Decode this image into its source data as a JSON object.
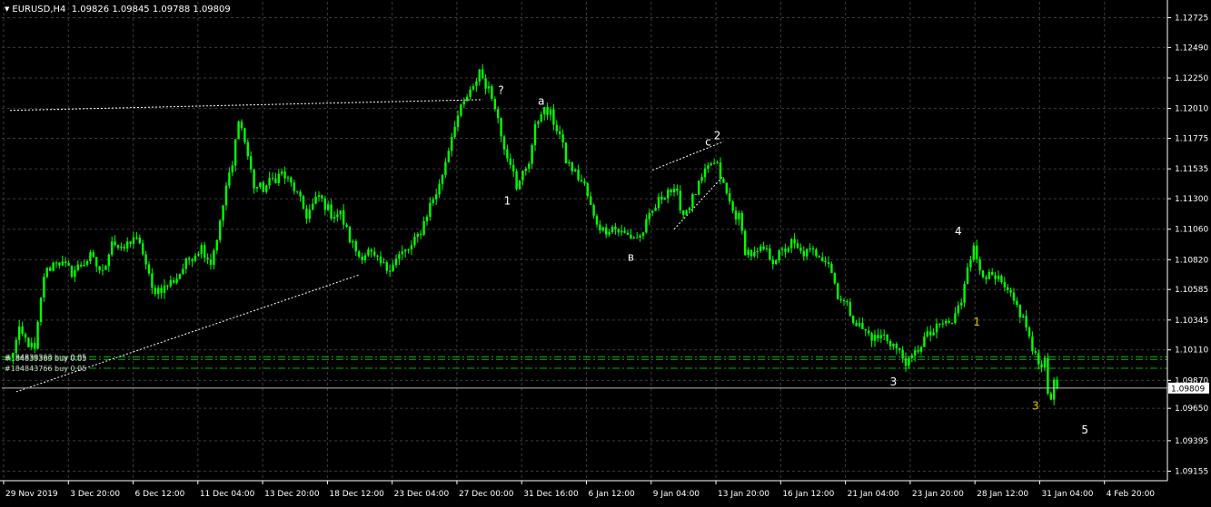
{
  "header": {
    "symbol": "EURUSD,H4",
    "open": "1.09826",
    "high": "1.09845",
    "low": "1.09788",
    "close": "1.09809"
  },
  "colors": {
    "background": "#000000",
    "grid": "#3c3c3c",
    "candle": "#00ff00",
    "axis": "#ffffff",
    "order_line": "#00b400",
    "wave_label": "#ffffff",
    "wave_label_alt": "#e6c800"
  },
  "chart_data": {
    "type": "candlestick",
    "ylim": [
      1.0908,
      1.1285
    ],
    "y_ticks": [
      "1.12725",
      "1.12490",
      "1.12250",
      "1.12010",
      "1.11775",
      "1.11535",
      "1.11300",
      "1.11060",
      "1.10820",
      "1.10585",
      "1.10345",
      "1.10110",
      "1.09870",
      "1.09650",
      "1.09395",
      "1.09155"
    ],
    "x_ticks": [
      "29 Nov 2019",
      "3 Dec 20:00",
      "6 Dec 12:00",
      "11 Dec 04:00",
      "13 Dec 20:00",
      "18 Dec 12:00",
      "23 Dec 04:00",
      "27 Dec 00:00",
      "31 Dec 16:00",
      "6 Jan 12:00",
      "9 Jan 04:00",
      "13 Jan 20:00",
      "16 Jan 12:00",
      "21 Jan 04:00",
      "23 Jan 20:00",
      "28 Jan 12:00",
      "31 Jan 04:00",
      "4 Feb 20:00"
    ],
    "current_price": "1.09809",
    "price_path": [
      [
        0,
        1.1003
      ],
      [
        3,
        1.1025
      ],
      [
        8,
        1.101
      ],
      [
        11,
        1.107
      ],
      [
        15,
        1.1082
      ],
      [
        20,
        1.1072
      ],
      [
        26,
        1.1084
      ],
      [
        30,
        1.1071
      ],
      [
        33,
        1.1098
      ],
      [
        36,
        1.1088
      ],
      [
        40,
        1.11
      ],
      [
        43,
        1.1088
      ],
      [
        46,
        1.1058
      ],
      [
        50,
        1.106
      ],
      [
        54,
        1.1068
      ],
      [
        58,
        1.1083
      ],
      [
        62,
        1.1092
      ],
      [
        65,
        1.108
      ],
      [
        68,
        1.111
      ],
      [
        70,
        1.114
      ],
      [
        72,
        1.1155
      ],
      [
        74,
        1.1195
      ],
      [
        76,
        1.1175
      ],
      [
        79,
        1.114
      ],
      [
        82,
        1.1138
      ],
      [
        85,
        1.1145
      ],
      [
        88,
        1.115
      ],
      [
        92,
        1.1138
      ],
      [
        96,
        1.1117
      ],
      [
        100,
        1.1132
      ],
      [
        104,
        1.1118
      ],
      [
        107,
        1.1118
      ],
      [
        110,
        1.1098
      ],
      [
        113,
        1.1085
      ],
      [
        116,
        1.1088
      ],
      [
        119,
        1.108
      ],
      [
        122,
        1.1075
      ],
      [
        126,
        1.1085
      ],
      [
        130,
        1.1092
      ],
      [
        133,
        1.1105
      ],
      [
        136,
        1.1125
      ],
      [
        139,
        1.114
      ],
      [
        142,
        1.117
      ],
      [
        144,
        1.119
      ],
      [
        146,
        1.12
      ],
      [
        148,
        1.121
      ],
      [
        150,
        1.1216
      ],
      [
        152,
        1.1232
      ],
      [
        153,
        1.1225
      ],
      [
        155,
        1.1215
      ],
      [
        157,
        1.1205
      ],
      [
        159,
        1.118
      ],
      [
        161,
        1.1165
      ],
      [
        163,
        1.1155
      ],
      [
        164,
        1.1135
      ],
      [
        166,
        1.115
      ],
      [
        168,
        1.116
      ],
      [
        170,
        1.1185
      ],
      [
        172,
        1.12
      ],
      [
        175,
        1.1196
      ],
      [
        178,
        1.118
      ],
      [
        180,
        1.116
      ],
      [
        183,
        1.115
      ],
      [
        186,
        1.114
      ],
      [
        189,
        1.1115
      ],
      [
        192,
        1.1105
      ],
      [
        195,
        1.1108
      ],
      [
        198,
        1.1103
      ],
      [
        201,
        1.11
      ],
      [
        204,
        1.11
      ],
      [
        207,
        1.1115
      ],
      [
        210,
        1.1128
      ],
      [
        213,
        1.1138
      ],
      [
        216,
        1.1132
      ],
      [
        218,
        1.1118
      ],
      [
        221,
        1.113
      ],
      [
        224,
        1.1145
      ],
      [
        227,
        1.1158
      ],
      [
        229,
        1.1155
      ],
      [
        231,
        1.114
      ],
      [
        234,
        1.112
      ],
      [
        236,
        1.1115
      ],
      [
        238,
        1.109
      ],
      [
        241,
        1.1085
      ],
      [
        244,
        1.109
      ],
      [
        247,
        1.1082
      ],
      [
        250,
        1.1088
      ],
      [
        253,
        1.1095
      ],
      [
        256,
        1.1087
      ],
      [
        259,
        1.1088
      ],
      [
        262,
        1.1087
      ],
      [
        265,
        1.108
      ],
      [
        268,
        1.1055
      ],
      [
        271,
        1.1045
      ],
      [
        274,
        1.1032
      ],
      [
        277,
        1.1025
      ],
      [
        280,
        1.102
      ],
      [
        283,
        1.1022
      ],
      [
        286,
        1.1015
      ],
      [
        289,
        1.1005
      ],
      [
        291,
        1.1
      ],
      [
        293,
        1.1008
      ],
      [
        296,
        1.102
      ],
      [
        299,
        1.1025
      ],
      [
        302,
        1.1032
      ],
      [
        305,
        1.1032
      ],
      [
        308,
        1.105
      ],
      [
        310,
        1.108
      ],
      [
        312,
        1.109
      ],
      [
        314,
        1.1075
      ],
      [
        317,
        1.1068
      ],
      [
        320,
        1.1065
      ],
      [
        323,
        1.1055
      ],
      [
        326,
        1.1045
      ],
      [
        329,
        1.103
      ],
      [
        331,
        1.101
      ],
      [
        333,
        1.1
      ],
      [
        335,
        1.1003
      ],
      [
        336,
        1.098
      ],
      [
        337,
        1.0975
      ],
      [
        338,
        1.0983
      ],
      [
        339,
        1.0981
      ]
    ],
    "wave_labels": [
      {
        "text": "?",
        "bar": 159,
        "price": 1.12125,
        "color": "wave_label"
      },
      {
        "text": "a",
        "bar": 172,
        "price": 1.1204,
        "color": "wave_label"
      },
      {
        "text": "1",
        "bar": 161,
        "price": 1.11255,
        "color": "wave_label"
      },
      {
        "text": "2",
        "bar": 229,
        "price": 1.1177,
        "color": "wave_label"
      },
      {
        "text": "c",
        "bar": 226,
        "price": 1.1172,
        "color": "wave_label"
      },
      {
        "text": "в",
        "bar": 201,
        "price": 1.1081,
        "color": "wave_label"
      },
      {
        "text": "4",
        "bar": 307,
        "price": 1.11015,
        "color": "wave_label"
      },
      {
        "text": "1",
        "bar": 313,
        "price": 1.103,
        "color": "wave_label_alt"
      },
      {
        "text": "3",
        "bar": 286,
        "price": 1.0983,
        "color": "wave_label"
      },
      {
        "text": "3",
        "bar": 332,
        "price": 1.0964,
        "color": "wave_label_alt"
      },
      {
        "text": "5",
        "bar": 348,
        "price": 1.0945,
        "color": "wave_label"
      }
    ],
    "trend_lines": [
      {
        "from": [
          0,
          1.11995
        ],
        "to": [
          153,
          1.1208
        ]
      },
      {
        "from": [
          2,
          1.0978
        ],
        "to": [
          113,
          1.107
        ]
      },
      {
        "from": [
          208,
          1.11525
        ],
        "to": [
          231,
          1.1175
        ]
      },
      {
        "from": [
          215,
          1.1106
        ],
        "to": [
          231,
          1.1148
        ]
      }
    ],
    "order_lines": [
      {
        "label": "#184839363 buy 0.05",
        "price": 1.10055
      },
      {
        "label": "#184839369 buy 0.05",
        "price": 1.10035
      },
      {
        "label": "#184843766 buy 0.05",
        "price": 1.09965
      }
    ]
  }
}
